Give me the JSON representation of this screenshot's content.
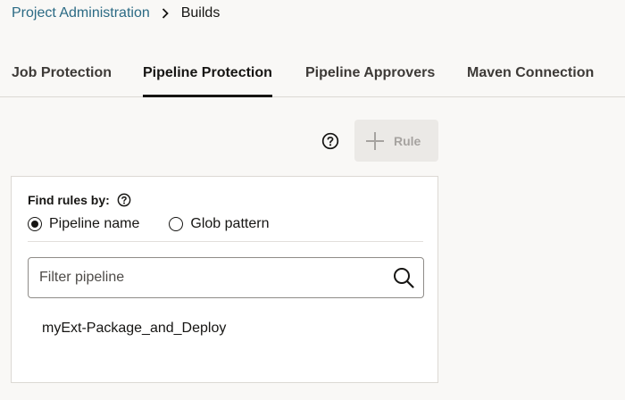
{
  "breadcrumb": {
    "parent": "Project Administration",
    "current": "Builds"
  },
  "tabs": [
    {
      "label": "Job Protection",
      "active": false
    },
    {
      "label": "Pipeline Protection",
      "active": true
    },
    {
      "label": "Pipeline Approvers",
      "active": false
    },
    {
      "label": "Maven Connection",
      "active": false
    }
  ],
  "toolbar": {
    "help_icon": "help-circle-icon",
    "add_rule_label": "Rule",
    "add_rule_icon": "plus-icon",
    "add_rule_disabled": true
  },
  "panel": {
    "find_label": "Find rules by:",
    "radios": [
      {
        "label": "Pipeline name",
        "selected": true
      },
      {
        "label": "Glob pattern",
        "selected": false
      }
    ],
    "search": {
      "placeholder": "Filter pipeline",
      "value": ""
    },
    "pipelines": [
      "myExt-Package_and_Deploy"
    ]
  },
  "colors": {
    "link": "#2b6a84",
    "background": "#f9f8f6",
    "text": "#161513"
  }
}
